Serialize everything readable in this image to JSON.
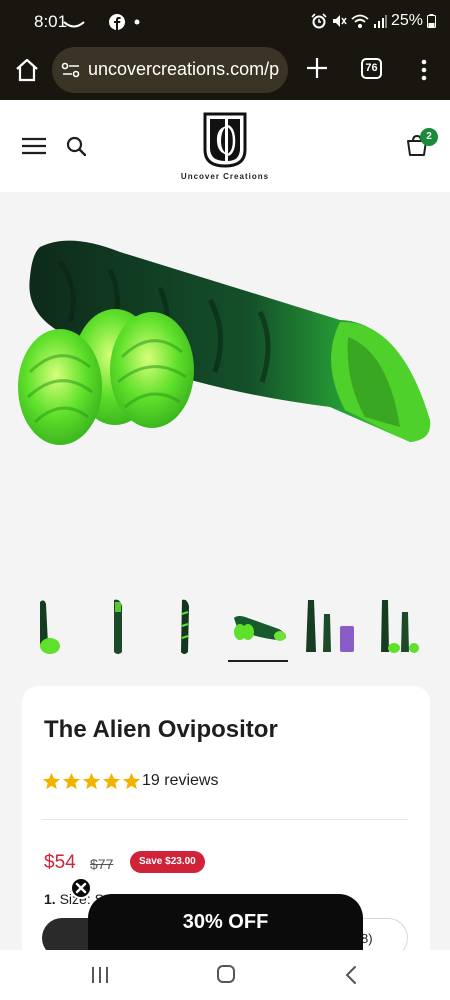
{
  "status_bar": {
    "time": "8:01",
    "battery": "25%",
    "icons": [
      "missed-call-icon",
      "facebook-icon",
      "dot-icon",
      "alarm-icon",
      "mute-icon",
      "wifi-icon",
      "signal-icon",
      "battery-icon"
    ]
  },
  "browser": {
    "url": "uncovercreations.com/p",
    "tab_count": "76",
    "theme_color": "#191610"
  },
  "header": {
    "brand_name": "Uncover Creations",
    "cart_count": "2",
    "badge_color": "#1b8a3a"
  },
  "gallery": {
    "thumbnail_count": 7,
    "active_index": 3
  },
  "product": {
    "title": "The Alien Ovipositor",
    "rating": 5,
    "reviews_label": "19 reviews",
    "price": "$54",
    "compare_at_price": "$77",
    "save_label": "Save $23.00",
    "size_label_num": "1.",
    "size_label_text": "Size:",
    "size_selected_partial": "S...",
    "option_partial": "8)",
    "accent_color": "#d0233a",
    "star_color": "#f2b200"
  },
  "promo": {
    "label": "30% OFF"
  },
  "nav": {
    "icons": [
      "recent-apps-icon",
      "home-icon",
      "back-icon"
    ]
  }
}
